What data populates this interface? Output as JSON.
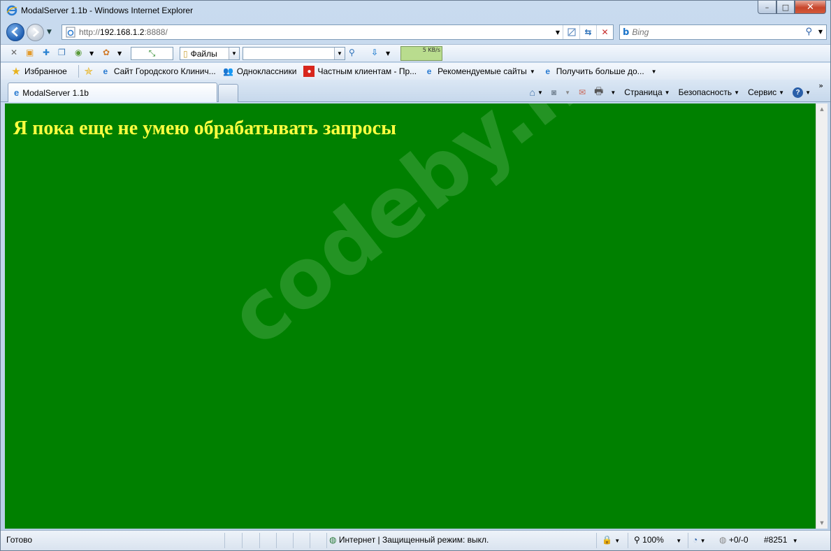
{
  "window": {
    "title": "ModalServer 1.1b - Windows Internet Explorer",
    "controls": {
      "minimize": "–",
      "maximize": "□",
      "close": "✕"
    }
  },
  "address": {
    "url_prefix": "http://",
    "url_host": "192.168.1.2",
    "url_suffix": ":8888/"
  },
  "search": {
    "provider": "b",
    "placeholder": "Bing"
  },
  "toolbar": {
    "files_label": "Файлы",
    "speed_label": "5 KB/s"
  },
  "favorites": {
    "label": "Избранное",
    "items": [
      "Сайт Городского Клинич...",
      "Одноклассники",
      "Частным клиентам - Пр...",
      "Рекомендуемые сайты",
      "Получить больше до..."
    ]
  },
  "tab": {
    "title": "ModalServer 1.1b"
  },
  "commands": {
    "page": "Страница",
    "safety": "Безопасность",
    "tools": "Сервис"
  },
  "page": {
    "heading": "Я пока еще не умею обрабатывать запросы",
    "watermark": "codeby.net"
  },
  "status": {
    "left": "Готово",
    "zone": "Интернет | Защищенный режим: выкл.",
    "zoom": "100%",
    "counter_a": "+0/-0",
    "counter_b": "#8251"
  },
  "colors": {
    "page_bg": "#008000",
    "heading": "#ffff40"
  }
}
